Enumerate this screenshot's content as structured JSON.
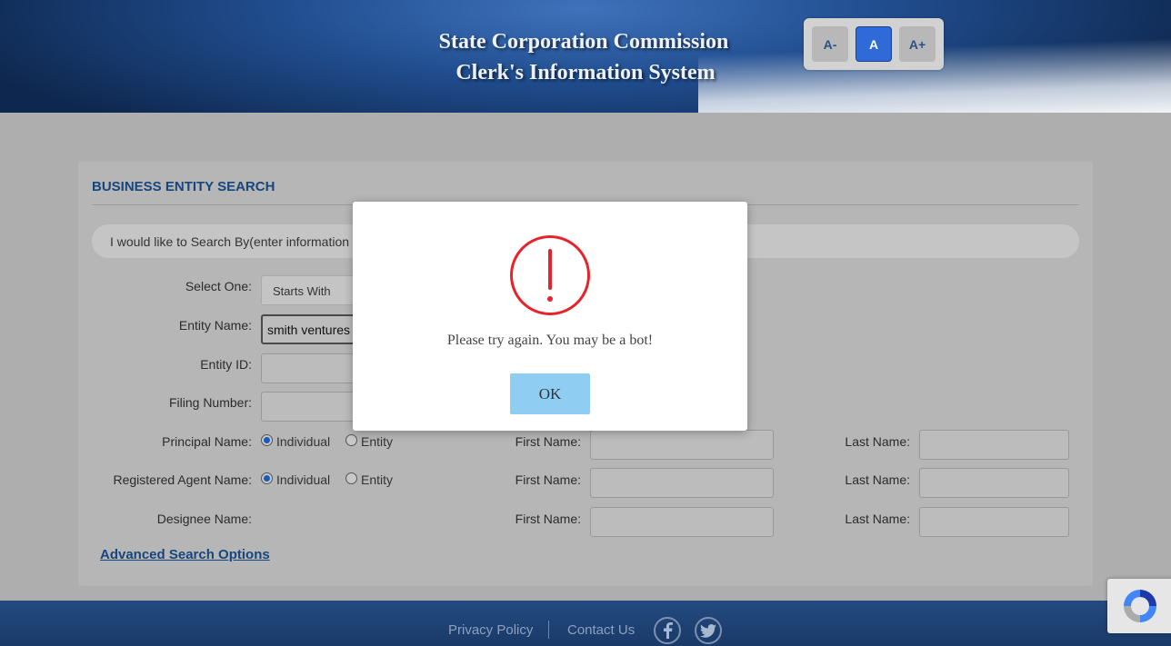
{
  "header": {
    "title_line1": "State Corporation Commission",
    "title_line2": "Clerk's Information System",
    "font_controls": [
      "A-",
      "A",
      "A+"
    ]
  },
  "panel": {
    "title": "BUSINESS ENTITY SEARCH",
    "search_by": "I would like to Search By(enter information",
    "fields": {
      "select_one_label": "Select One:",
      "select_one_value": "Starts With",
      "entity_name_label": "Entity Name:",
      "entity_name_value": "smith ventures",
      "entity_id_label": "Entity ID:",
      "filing_number_label": "Filing Number:",
      "principal_name_label": "Principal Name:",
      "registered_agent_label": "Registered Agent Name:",
      "designee_label": "Designee Name:",
      "individual": "Individual",
      "entity": "Entity",
      "first_name": "First Name:",
      "last_name": "Last Name:"
    },
    "advanced": "Advanced Search Options"
  },
  "modal": {
    "message": "Please try again. You may be a bot!",
    "ok": "OK"
  },
  "footer": {
    "privacy": "Privacy Policy",
    "contact": "Contact Us"
  },
  "colors": {
    "header_blue": "#214e90",
    "accent_blue": "#17467e",
    "alert_red": "#e8222a",
    "ok_button": "#8fcdf2"
  },
  "icons": {
    "alert": "exclamation-circle-icon",
    "facebook": "facebook-icon",
    "twitter": "twitter-icon",
    "recaptcha": "recaptcha-icon"
  }
}
